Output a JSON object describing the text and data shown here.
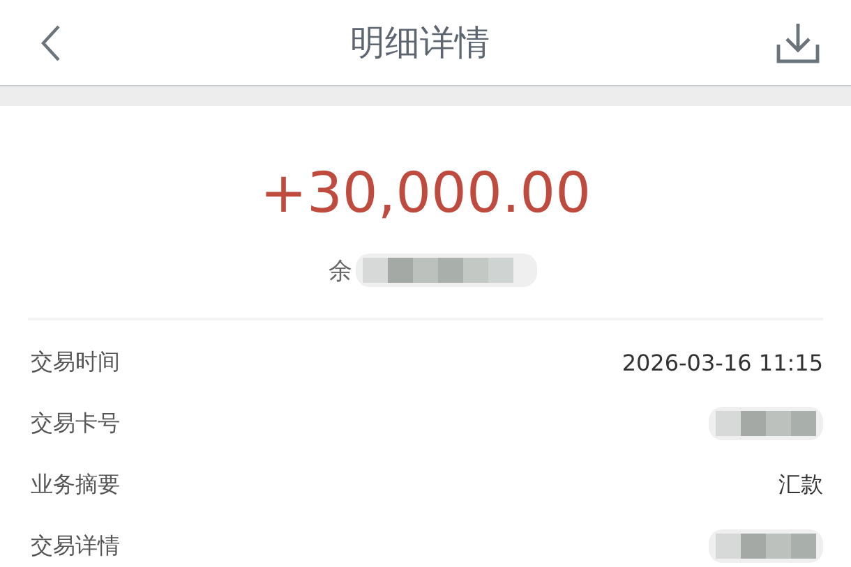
{
  "header": {
    "title": "明细详情"
  },
  "summary": {
    "amount": "+30,000.00",
    "balance_label": "余",
    "balance_redacted": true
  },
  "details": [
    {
      "label": "交易时间",
      "value": "2026-03-16 11:15",
      "redacted": false
    },
    {
      "label": "交易卡号",
      "redacted": true
    },
    {
      "label": "业务摘要",
      "value": "汇款",
      "redacted": false
    },
    {
      "label": "交易详情",
      "redacted": true
    }
  ]
}
